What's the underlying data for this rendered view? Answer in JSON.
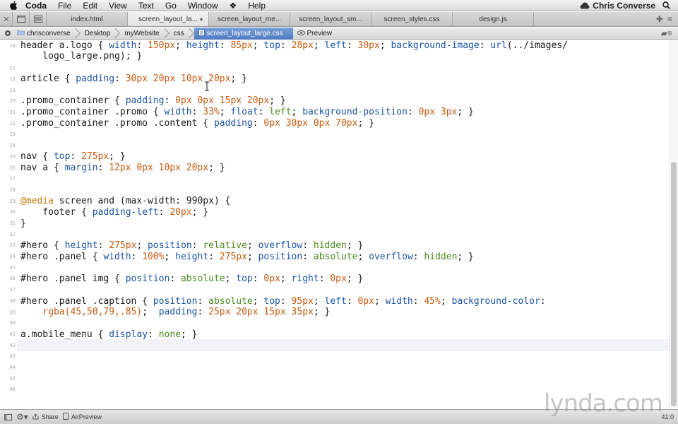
{
  "menubar": {
    "app_name": "Coda",
    "items": [
      "File",
      "Edit",
      "View",
      "Text",
      "Go",
      "Window",
      "Help"
    ],
    "user": "Chris Converse"
  },
  "tabs": [
    {
      "label": "index.html",
      "active": false
    },
    {
      "label": "screen_layout_la...",
      "active": true
    },
    {
      "label": "screen_layout_me...",
      "active": false
    },
    {
      "label": "screen_layout_sm...",
      "active": false
    },
    {
      "label": "screen_styles.css",
      "active": false
    },
    {
      "label": "design.js",
      "active": false
    }
  ],
  "pathbar": {
    "crumbs": [
      "chrisconverse",
      "Desktop",
      "myWebsite",
      "css",
      "screen_layout_large.css"
    ],
    "preview_label": "Preview"
  },
  "editor": {
    "line_numbers": [
      "16",
      "17",
      "18",
      "19",
      "20",
      "21",
      "22",
      "23",
      "24",
      "25",
      "26",
      "27",
      "28",
      "29",
      "30",
      "31",
      "32",
      "33",
      "34",
      "35",
      "36",
      "37",
      "38",
      "39",
      "40",
      "41",
      "42",
      "43",
      "44",
      "45",
      "46"
    ]
  },
  "statusbar": {
    "share_label": "Share",
    "airpreview_label": "AirPreview",
    "position": "41:0"
  },
  "watermark": "lynda.com",
  "colors": {
    "property": "#1b54a4",
    "value": "#c85a0f",
    "keyword": "#4b8b1e",
    "at_rule": "#c87a0f"
  }
}
